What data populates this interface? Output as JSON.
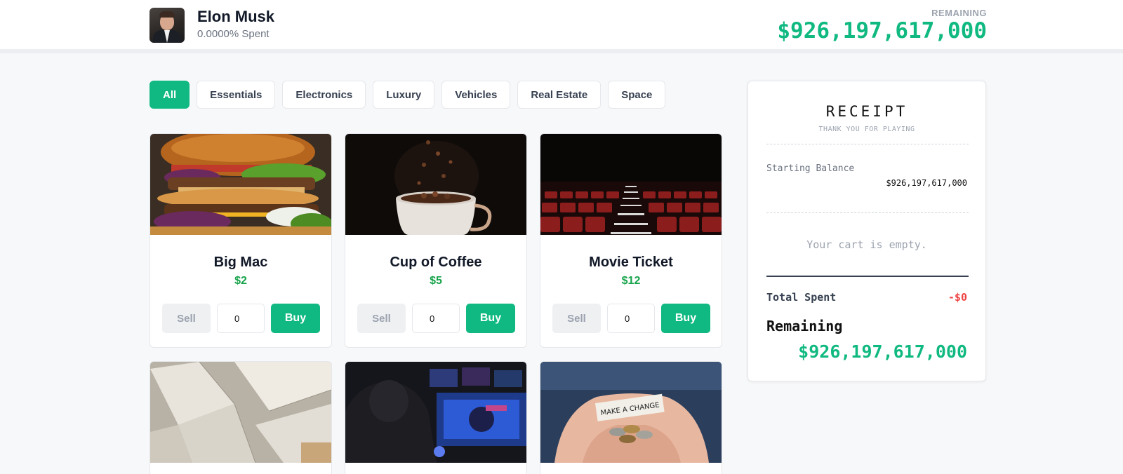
{
  "header": {
    "name": "Elon Musk",
    "spent_text": "0.0000% Spent",
    "remaining_label": "REMAINING",
    "remaining_value": "$926,197,617,000"
  },
  "tabs": [
    {
      "label": "All",
      "active": true
    },
    {
      "label": "Essentials",
      "active": false
    },
    {
      "label": "Electronics",
      "active": false
    },
    {
      "label": "Luxury",
      "active": false
    },
    {
      "label": "Vehicles",
      "active": false
    },
    {
      "label": "Real Estate",
      "active": false
    },
    {
      "label": "Space",
      "active": false
    }
  ],
  "products": [
    {
      "name": "Big Mac",
      "price": "$2",
      "quantity": "0",
      "sell_label": "Sell",
      "buy_label": "Buy"
    },
    {
      "name": "Cup of Coffee",
      "price": "$5",
      "quantity": "0",
      "sell_label": "Sell",
      "buy_label": "Buy"
    },
    {
      "name": "Movie Ticket",
      "price": "$12",
      "quantity": "0",
      "sell_label": "Sell",
      "buy_label": "Buy"
    },
    {
      "name": "",
      "price": "",
      "quantity": "",
      "sell_label": "",
      "buy_label": ""
    },
    {
      "name": "",
      "price": "",
      "quantity": "",
      "sell_label": "",
      "buy_label": ""
    },
    {
      "name": "",
      "price": "",
      "quantity": "",
      "sell_label": "",
      "buy_label": ""
    }
  ],
  "receipt": {
    "title": "RECEIPT",
    "subtitle": "THANK YOU FOR PLAYING",
    "starting_balance_label": "Starting Balance",
    "starting_balance_value": "$926,197,617,000",
    "empty_message": "Your cart is empty.",
    "total_spent_label": "Total Spent",
    "total_spent_value": "-$0",
    "remaining_label": "Remaining",
    "remaining_value": "$926,197,617,000"
  },
  "colors": {
    "accent": "#10b981",
    "price": "#16a34a",
    "negative": "#ef4444",
    "background": "#f7f8fa"
  }
}
